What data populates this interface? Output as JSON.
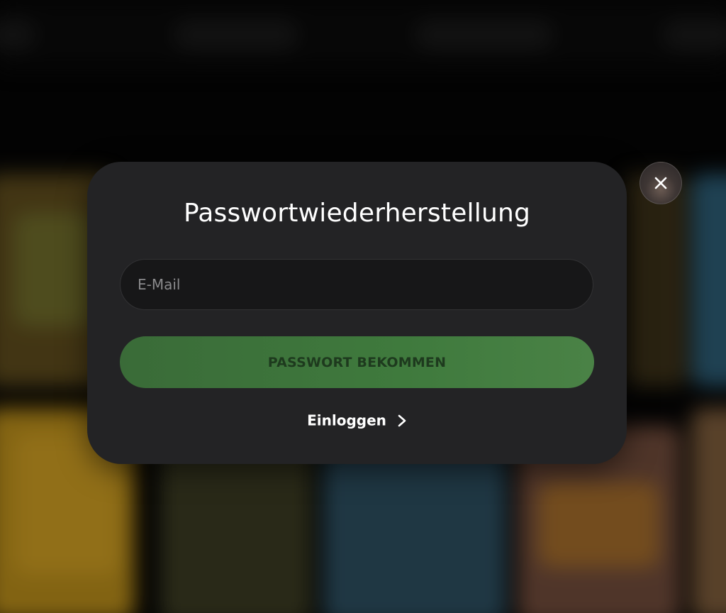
{
  "modal": {
    "title": "Passwortwiederherstellung",
    "email": {
      "placeholder": "E-Mail",
      "value": ""
    },
    "submit_label": "PASSWORT BEKOMMEN",
    "login_link_label": "Einloggen"
  },
  "icons": {
    "close": "close-icon",
    "login_chevron": "chevron-right-icon"
  },
  "colors": {
    "modal_background": "#232325",
    "submit_button": "#3f7a3d",
    "submit_text": "#1e3a1e",
    "input_background": "#171718"
  }
}
